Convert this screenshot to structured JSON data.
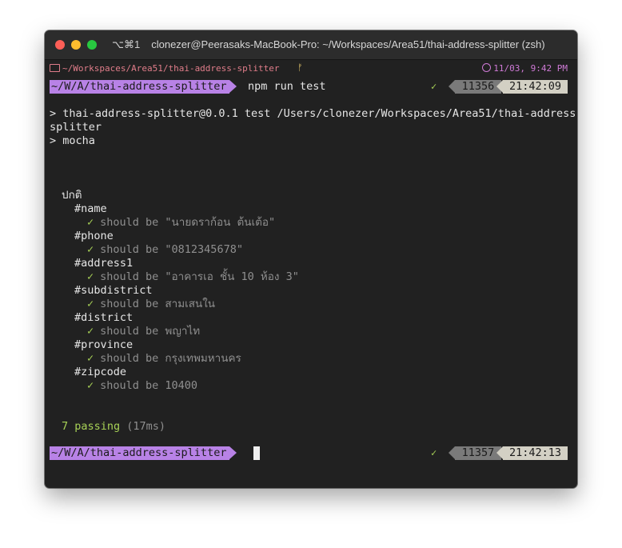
{
  "window": {
    "shortcut": "⌥⌘1",
    "title": "clonezer@Peerasaks-MacBook-Pro: ~/Workspaces/Area51/thai-address-splitter (zsh)"
  },
  "status_line": {
    "folder_path": "~/Workspaces/Area51/thai-address-splitter",
    "branch_icon": "git-branch-icon",
    "datetime": "11/03, 9:42 PM"
  },
  "prompt1": {
    "path": "~/W/A/thai-address-splitter",
    "command": "npm run test",
    "check": "✓",
    "history": "11356",
    "time": "21:42:09"
  },
  "output": {
    "line1": "> thai-address-splitter@0.0.1 test /Users/clonezer/Workspaces/Area51/thai-address-",
    "line2": "splitter",
    "line3": "> mocha"
  },
  "suite": {
    "name": "ปกติ",
    "groups": [
      {
        "name": "#name",
        "test": "should be \"นายดราก้อน ต้นเต้อ\""
      },
      {
        "name": "#phone",
        "test": "should be \"0812345678\""
      },
      {
        "name": "#address1",
        "test": "should be \"อาคารเอ ชั้น 10 ห้อง 3\""
      },
      {
        "name": "#subdistrict",
        "test": "should be สามเสนใน"
      },
      {
        "name": "#district",
        "test": "should be พญาไท"
      },
      {
        "name": "#province",
        "test": "should be กรุงเทพมหานคร"
      },
      {
        "name": "#zipcode",
        "test": "should be 10400"
      }
    ],
    "tick": "✓"
  },
  "summary": {
    "passing": "7 passing",
    "duration": "(17ms)"
  },
  "prompt2": {
    "path": "~/W/A/thai-address-splitter",
    "check": "✓",
    "history": "11357",
    "time": "21:42:13"
  }
}
